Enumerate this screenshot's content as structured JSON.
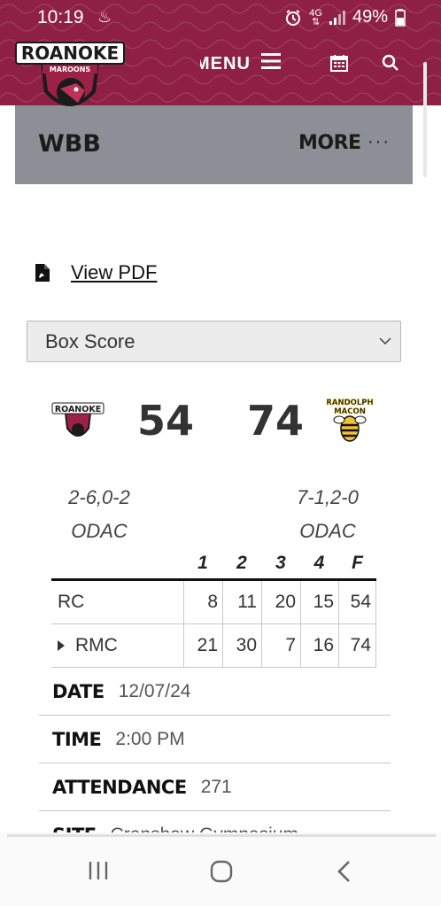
{
  "status_bar": {
    "time": "10:19",
    "battery": "49%",
    "network": "4G"
  },
  "header": {
    "logo_alt": "Roanoke Maroons",
    "logo_text_1": "ROANOKE",
    "logo_text_2": "MAROONS",
    "menu_label": "MENU",
    "brand_color": "#8e1f45"
  },
  "subnav": {
    "title": "WBB",
    "more_label": "MORE",
    "dots": "···"
  },
  "pdf_link": "View PDF",
  "select": {
    "value": "Box Score"
  },
  "game": {
    "home": {
      "name": "RC",
      "logo_text": "ROANOKE",
      "score": "54",
      "record_overall": "2-6,0-2",
      "record_conf": "ODAC"
    },
    "away": {
      "name": "RMC",
      "logo_text_1": "RANDOLPH",
      "logo_text_2": "MACON",
      "score": "74",
      "record_overall": "7-1,2-0",
      "record_conf": "ODAC"
    }
  },
  "linescore": {
    "headers": [
      "1",
      "2",
      "3",
      "4",
      "F"
    ],
    "rows": [
      {
        "team": "RC",
        "periods": [
          "8",
          "11",
          "20",
          "15",
          "54"
        ]
      },
      {
        "team": "RMC",
        "periods": [
          "21",
          "30",
          "7",
          "16",
          "74"
        ]
      }
    ]
  },
  "info": {
    "date_label": "DATE",
    "date_value": "12/07/24",
    "time_label": "TIME",
    "time_value": "2:00 PM",
    "attendance_label": "ATTENDANCE",
    "attendance_value": "271",
    "site_label": "SITE",
    "site_value": "Crenshaw Gymnasium"
  },
  "icons": {
    "menu": "hamburger-icon",
    "calendar": "calendar-icon",
    "search": "search-icon",
    "pdf": "pdf-icon",
    "chevron": "chevron-down-icon"
  }
}
